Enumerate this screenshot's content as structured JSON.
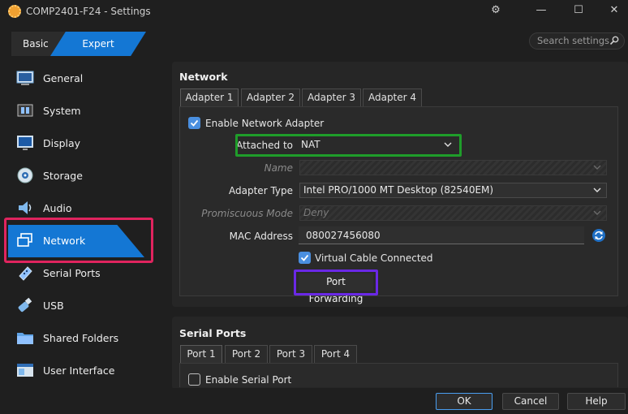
{
  "window": {
    "title": "COMP2401-F24 - Settings",
    "controls": {
      "settings": "⚙",
      "minimize": "—",
      "maximize": "☐",
      "close": "✕"
    }
  },
  "mode_tabs": {
    "basic": "Basic",
    "expert": "Expert",
    "active": "Expert"
  },
  "search": {
    "placeholder": "Search settings"
  },
  "sidebar": {
    "items": [
      {
        "label": "General",
        "icon": "general-icon"
      },
      {
        "label": "System",
        "icon": "system-chip-icon"
      },
      {
        "label": "Display",
        "icon": "monitor-icon"
      },
      {
        "label": "Storage",
        "icon": "disk-icon"
      },
      {
        "label": "Audio",
        "icon": "speaker-icon"
      },
      {
        "label": "Network",
        "icon": "network-icon"
      },
      {
        "label": "Serial Ports",
        "icon": "serial-port-icon"
      },
      {
        "label": "USB",
        "icon": "usb-icon"
      },
      {
        "label": "Shared Folders",
        "icon": "folder-icon"
      },
      {
        "label": "User Interface",
        "icon": "window-icon"
      }
    ],
    "active": "Network"
  },
  "network": {
    "title": "Network",
    "tabs": [
      "Adapter 1",
      "Adapter 2",
      "Adapter 3",
      "Adapter 4"
    ],
    "active_tab": "Adapter 1",
    "enable_adapter": {
      "label": "Enable Network Adapter",
      "checked": true
    },
    "attached_to": {
      "label": "Attached to",
      "value": "NAT"
    },
    "name": {
      "label": "Name",
      "value": ""
    },
    "adapter_type": {
      "label": "Adapter Type",
      "value": "Intel PRO/1000 MT Desktop (82540EM)"
    },
    "promiscuous_mode": {
      "label": "Promiscuous Mode",
      "value": "Deny"
    },
    "mac_address": {
      "label": "MAC Address",
      "value": "080027456080"
    },
    "cable_connected": {
      "label": "Virtual Cable Connected",
      "checked": true
    },
    "port_forwarding": {
      "label": "Port Forwarding"
    }
  },
  "serial_ports": {
    "title": "Serial Ports",
    "tabs": [
      "Port 1",
      "Port 2",
      "Port 3",
      "Port 4"
    ],
    "active_tab": "Port 1",
    "enable_serial": {
      "label": "Enable Serial Port",
      "checked": false
    }
  },
  "footer": {
    "ok": "OK",
    "cancel": "Cancel",
    "help": "Help"
  },
  "colors": {
    "accent": "#1477d4",
    "highlight_network": "#e0245e",
    "highlight_attached": "#1f9d2a",
    "highlight_port_forwarding": "#6a28e6"
  }
}
